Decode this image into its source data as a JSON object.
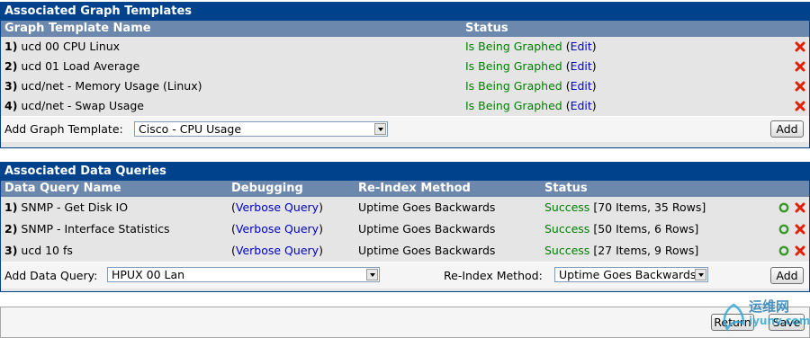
{
  "graph_templates": {
    "title": "Associated Graph Templates",
    "columns": {
      "name": "Graph Template Name",
      "status": "Status"
    },
    "rows": [
      {
        "num": "1)",
        "name": "ucd 00 CPU Linux",
        "status": "Is Being Graphed",
        "edit": "Edit"
      },
      {
        "num": "2)",
        "name": "ucd 01 Load Average",
        "status": "Is Being Graphed",
        "edit": "Edit"
      },
      {
        "num": "3)",
        "name": "ucd/net - Memory Usage (Linux)",
        "status": "Is Being Graphed",
        "edit": "Edit"
      },
      {
        "num": "4)",
        "name": "ucd/net - Swap Usage",
        "status": "Is Being Graphed",
        "edit": "Edit"
      }
    ],
    "add_label": "Add Graph Template:",
    "add_selected": "Cisco - CPU Usage",
    "add_button": "Add"
  },
  "data_queries": {
    "title": "Associated Data Queries",
    "columns": {
      "name": "Data Query Name",
      "debugging": "Debugging",
      "reindex": "Re-Index Method",
      "status": "Status"
    },
    "rows": [
      {
        "num": "1)",
        "name": "SNMP - Get Disk IO",
        "debug": "Verbose Query",
        "reindex": "Uptime Goes Backwards",
        "status": "Success",
        "detail": "[70 Items, 35 Rows]"
      },
      {
        "num": "2)",
        "name": "SNMP - Interface Statistics",
        "debug": "Verbose Query",
        "reindex": "Uptime Goes Backwards",
        "status": "Success",
        "detail": "[50 Items, 6 Rows]"
      },
      {
        "num": "3)",
        "name": "ucd 10 fs",
        "debug": "Verbose Query",
        "reindex": "Uptime Goes Backwards",
        "status": "Success",
        "detail": "[27 Items, 9 Rows]"
      }
    ],
    "add_label": "Add Data Query:",
    "add_selected": "HPUX 00 Lan",
    "reindex_label": "Re-Index Method:",
    "reindex_selected": "Uptime Goes Backwards",
    "add_button": "Add"
  },
  "footer": {
    "return_button": "Return",
    "save_button": "Save"
  },
  "watermark": {
    "text": "运维网",
    "sub": "iyunv.com"
  },
  "colors": {
    "title_bg": "#00438c",
    "header_bg": "#6d88ad",
    "success": "#008000",
    "link": "#0000cc",
    "delete": "#e02000",
    "reload": "#3a9a2a"
  }
}
